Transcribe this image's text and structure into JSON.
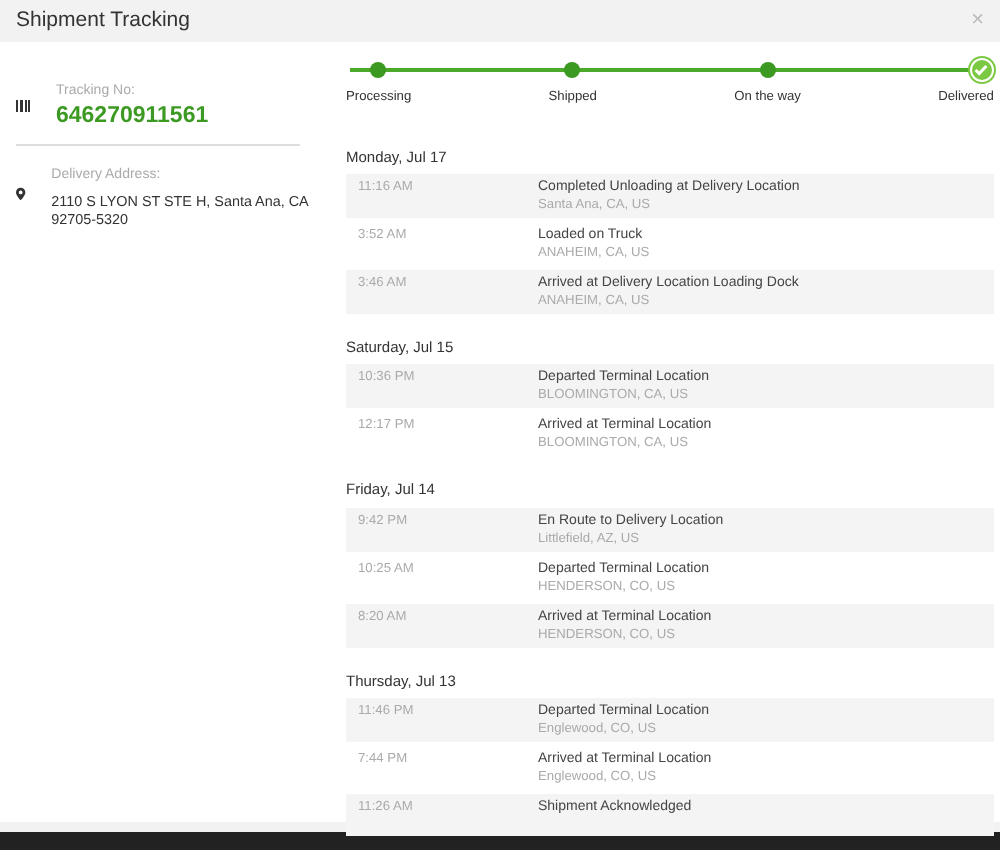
{
  "window": {
    "title": "Shipment Tracking",
    "close": "×"
  },
  "shipment": {
    "tracking_label": "Tracking No:",
    "tracking_number": "646270911561",
    "address_label": "Delivery Address:",
    "address": "2110 S LYON ST STE H, Santa Ana, CA 92705-5320"
  },
  "steps": [
    {
      "label": "Processing",
      "done": true,
      "current": false
    },
    {
      "label": "Shipped",
      "done": true,
      "current": false
    },
    {
      "label": "On the way",
      "done": true,
      "current": false
    },
    {
      "label": "Delivered",
      "done": true,
      "current": true
    }
  ],
  "days": [
    {
      "date": "Monday, Jul 17",
      "events": [
        {
          "time": "11:16 AM",
          "status": "Completed Unloading at Delivery Location",
          "location": "Santa Ana, CA, US"
        },
        {
          "time": "3:52 AM",
          "status": "Loaded on Truck",
          "location": "ANAHEIM, CA, US"
        },
        {
          "time": "3:46 AM",
          "status": "Arrived at Delivery Location Loading Dock",
          "location": "ANAHEIM, CA, US"
        }
      ]
    },
    {
      "date": "Saturday, Jul 15",
      "events": [
        {
          "time": "10:36 PM",
          "status": "Departed Terminal Location",
          "location": "BLOOMINGTON, CA, US"
        },
        {
          "time": "12:17 PM",
          "status": "Arrived at Terminal Location",
          "location": "BLOOMINGTON, CA, US"
        }
      ]
    },
    {
      "date": "Friday, Jul 14",
      "events": [
        {
          "time": "9:42 PM",
          "status": "En Route to Delivery Location",
          "location": "Littlefield, AZ, US"
        },
        {
          "time": "10:25 AM",
          "status": "Departed Terminal Location",
          "location": "HENDERSON, CO, US"
        },
        {
          "time": "8:20 AM",
          "status": "Arrived at Terminal Location",
          "location": "HENDERSON, CO, US"
        }
      ]
    },
    {
      "date": "Thursday, Jul 13",
      "events": [
        {
          "time": "11:46 PM",
          "status": "Departed Terminal Location",
          "location": "Englewood, CO, US"
        },
        {
          "time": "7:44 PM",
          "status": "Arrived at Terminal Location",
          "location": "Englewood, CO, US"
        },
        {
          "time": "11:26 AM",
          "status": "Shipment Acknowledged"
        }
      ]
    }
  ]
}
